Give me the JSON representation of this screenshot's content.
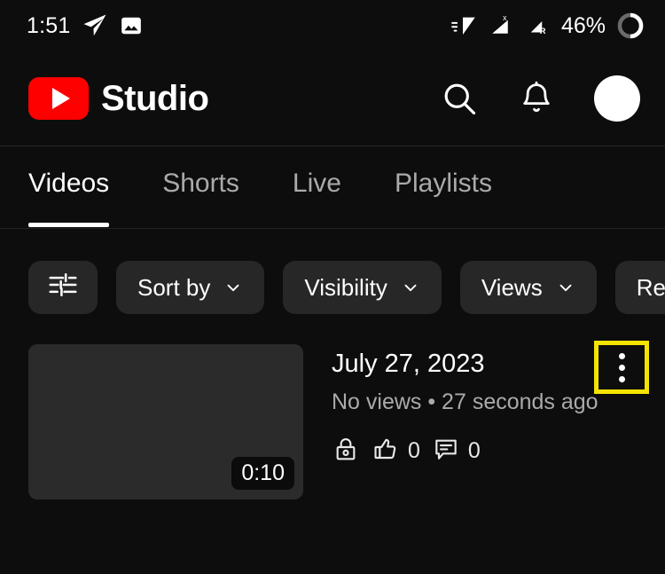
{
  "status_bar": {
    "time": "1:51",
    "battery_percent": "46%",
    "left_icons": [
      "telegram-send-icon",
      "image-icon"
    ],
    "right_icons": [
      "wifi-icon",
      "cellular-signal-x-icon",
      "cellular-signal-r-icon",
      "battery-circle-icon"
    ]
  },
  "header": {
    "logo_icon": "youtube-logo-icon",
    "title": "Studio",
    "brand_color": "#FF0000",
    "actions": [
      {
        "name": "search-icon",
        "label": "Search"
      },
      {
        "name": "notifications-bell-icon",
        "label": "Notifications"
      },
      {
        "name": "avatar",
        "label": "Account"
      }
    ]
  },
  "tabs": [
    {
      "label": "Videos",
      "active": true
    },
    {
      "label": "Shorts",
      "active": false
    },
    {
      "label": "Live",
      "active": false
    },
    {
      "label": "Playlists",
      "active": false
    }
  ],
  "filters": {
    "filter_icon": "tune-sliders-icon",
    "chips": [
      {
        "label": "Sort by",
        "chevron": true
      },
      {
        "label": "Visibility",
        "chevron": true
      },
      {
        "label": "Views",
        "chevron": true
      },
      {
        "label": "Restri",
        "chevron": false
      }
    ]
  },
  "video": {
    "title": "July 27, 2023",
    "meta": "No views • 27 seconds ago",
    "duration": "0:10",
    "visibility_icon": "lock-private-icon",
    "likes": "0",
    "comments": "0",
    "thumbnail_color": "#2b2b2b"
  },
  "more_menu": {
    "icon": "more-vertical-icon",
    "highlight_color": "#F5E400"
  }
}
